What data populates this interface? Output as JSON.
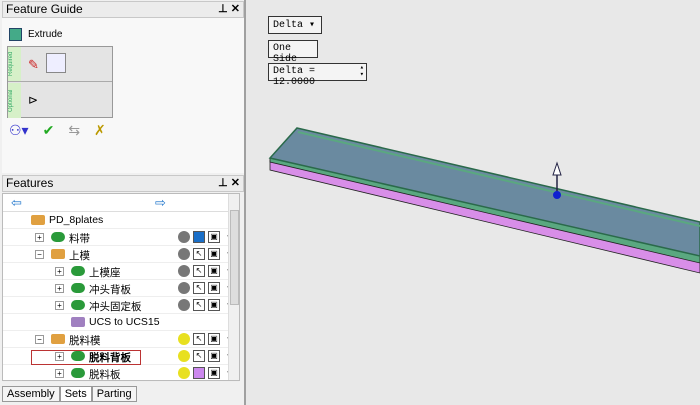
{
  "feature_guide": {
    "title": "Feature Guide",
    "feature": "Extrude",
    "required_label": "Required",
    "optional_label": "Optional"
  },
  "features": {
    "title": "Features",
    "rows": [
      {
        "label": "PD_8plates",
        "level": 0,
        "bulb": "",
        "color": ""
      },
      {
        "label": "料带",
        "level": 1,
        "exp": "+",
        "bulb": "#777",
        "color": "#1a6fc8"
      },
      {
        "label": "上模",
        "level": 1,
        "exp": "−",
        "bulb": "#777",
        "color": ""
      },
      {
        "label": "上模座",
        "level": 2,
        "exp": "+",
        "bulb": "#777",
        "color": ""
      },
      {
        "label": "冲头背板",
        "level": 2,
        "exp": "+",
        "bulb": "#777",
        "color": ""
      },
      {
        "label": "冲头固定板",
        "level": 2,
        "exp": "+",
        "bulb": "#777",
        "color": ""
      },
      {
        "label": "UCS to UCS15",
        "level": 2,
        "bulb": "",
        "color": ""
      },
      {
        "label": "脱料模",
        "level": 1,
        "exp": "−",
        "bulb": "#e8e020",
        "color": ""
      },
      {
        "label": "脱料背板",
        "level": 2,
        "exp": "+",
        "bulb": "#e8e020",
        "color": "",
        "bold": true
      },
      {
        "label": "脱料板",
        "level": 2,
        "exp": "+",
        "bulb": "#e8e020",
        "color": "#cc88ee"
      }
    ]
  },
  "tabs": [
    "Assembly",
    "Sets",
    "Parting"
  ],
  "controls": {
    "mode": "Delta ▾",
    "side": "One Side",
    "delta": "Delta = 12.0000"
  },
  "colors": {
    "top_face": "#6a8aa0",
    "edge": "#5aa880",
    "bottom": "#d88ee8",
    "handle": "#1020d0"
  }
}
